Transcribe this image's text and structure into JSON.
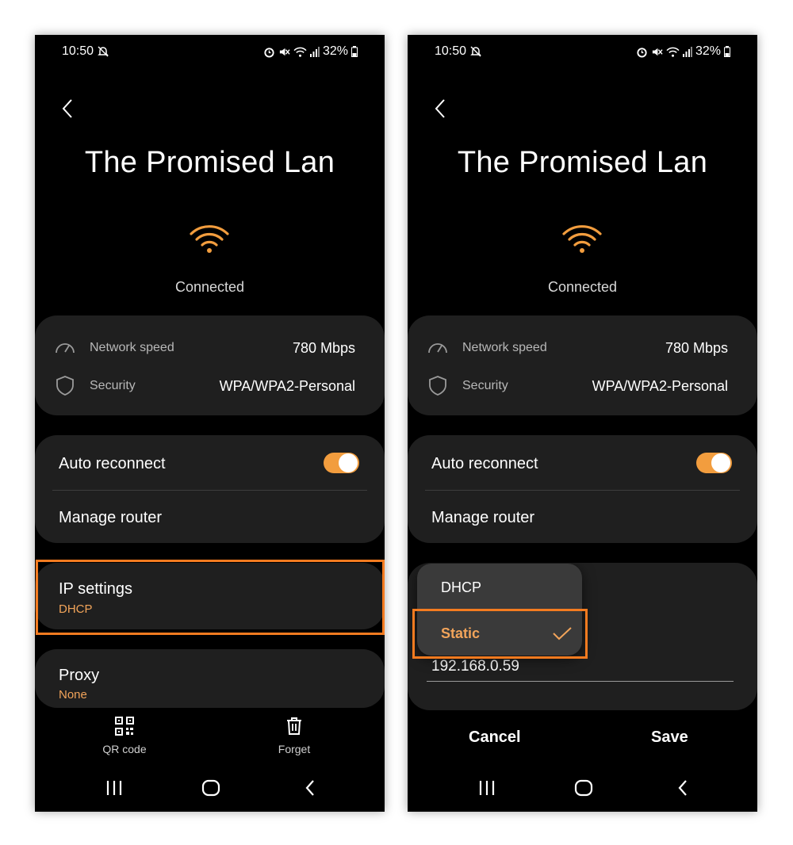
{
  "colors": {
    "accent": "#f29d3e",
    "highlight_frame": "#f47b20",
    "card_bg": "#1f1f1f",
    "screen_bg": "#000000"
  },
  "status_bar": {
    "time": "10:50",
    "battery": "32%",
    "icons": [
      "do-not-disturb-icon",
      "alarm-icon",
      "mute-icon",
      "wifi-icon",
      "signal-icon",
      "battery-icon"
    ]
  },
  "network": {
    "name": "The Promised Lan",
    "status": "Connected",
    "speed_label": "Network speed",
    "speed_value": "780 Mbps",
    "security_label": "Security",
    "security_value": "WPA/WPA2-Personal"
  },
  "settings": {
    "auto_reconnect_label": "Auto reconnect",
    "auto_reconnect_on": true,
    "manage_router_label": "Manage router",
    "ip_settings_label": "IP settings",
    "ip_settings_value": "DHCP",
    "proxy_label": "Proxy",
    "proxy_value": "None"
  },
  "bottom_actions": {
    "qr_label": "QR code",
    "forget_label": "Forget"
  },
  "dropdown": {
    "options": [
      "DHCP",
      "Static"
    ],
    "selected": "Static"
  },
  "ip_field": {
    "value": "192.168.0.59"
  },
  "dialog": {
    "cancel_label": "Cancel",
    "save_label": "Save"
  }
}
